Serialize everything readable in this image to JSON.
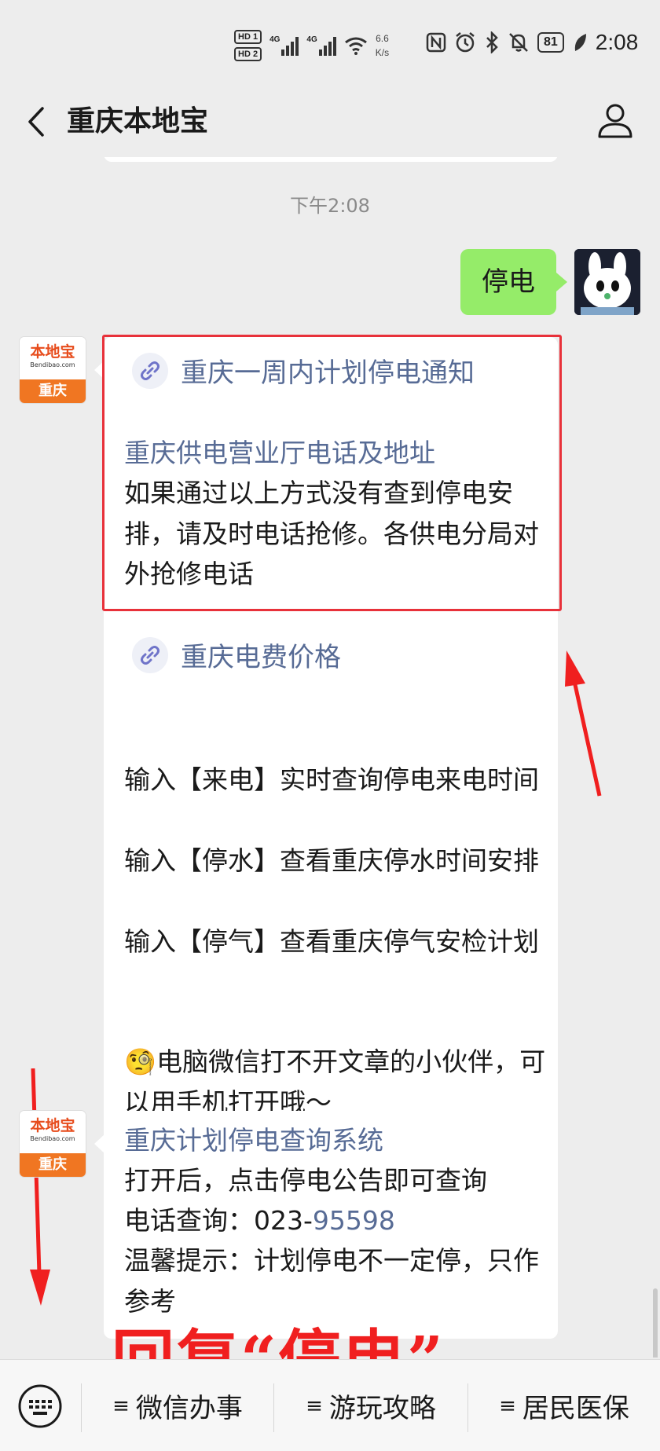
{
  "statusbar": {
    "hd1": "HD 1",
    "hd2": "HD 2",
    "signal_label": "4G",
    "net_speed_value": "6.6",
    "net_speed_unit": "K/s",
    "battery": "81",
    "time": "2:08"
  },
  "header": {
    "title": "重庆本地宝"
  },
  "chat": {
    "timestamp": "下午2:08",
    "user_message": "停电",
    "bot_avatar": {
      "name": "本地宝",
      "url": "Bendibao.com",
      "city": "重庆"
    },
    "message1": {
      "link1": "重庆一周内计划停电通知",
      "link2_title": "重庆供电营业厅电话及地址",
      "body": "如果通过以上方式没有查到停电安排，请及时电话抢修。各供电分局对外抢修电话",
      "link3": "重庆电费价格",
      "line1": "输入【来电】实时查询停电来电时间",
      "line2": "输入【停水】查看重庆停水时间安排",
      "line3": "输入【停气】查看重庆停气安检计划",
      "emoji": "🧐",
      "note": "电脑微信打不开文章的小伙伴，可以用手机打开哦～"
    },
    "message2": {
      "title": "重庆计划停电查询系统",
      "line1": "打开后，点击停电公告即可查询",
      "phone_prefix": "电话查询：023-",
      "phone_number": "95598",
      "tip": "温馨提示：计划停电不一定停，只作参考"
    },
    "annotation": "回复“停电”"
  },
  "menu": {
    "items": [
      {
        "label": "微信办事"
      },
      {
        "label": "游玩攻略"
      },
      {
        "label": "居民医保"
      }
    ]
  },
  "colors": {
    "accent_link": "#576b95",
    "bubble_green": "#95ec69",
    "annotation_red": "#f01f1f",
    "avatar_orange": "#f07622"
  }
}
